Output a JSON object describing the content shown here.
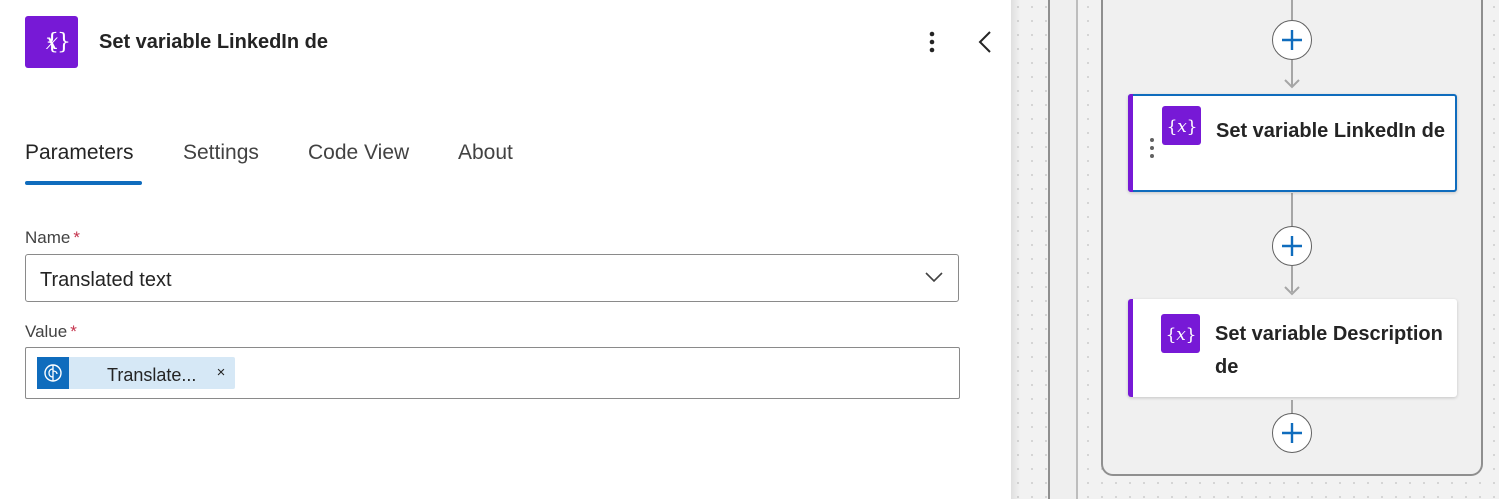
{
  "panel": {
    "title": "Set variable LinkedIn de",
    "icon": "variable-icon",
    "more_icon": "more-vertical-icon",
    "collapse_icon": "chevron-left-icon",
    "tabs": [
      {
        "label": "Parameters",
        "active": true
      },
      {
        "label": "Settings",
        "active": false
      },
      {
        "label": "Code View",
        "active": false
      },
      {
        "label": "About",
        "active": false
      }
    ],
    "fields": {
      "name": {
        "label": "Name",
        "required_mark": "*",
        "value": "Translated text",
        "icon": "chevron-down-icon"
      },
      "value": {
        "label": "Value",
        "required_mark": "*",
        "token": {
          "label": "Translate...",
          "icon": "ai-brain-icon",
          "close": "×"
        }
      }
    }
  },
  "canvas": {
    "nodes": [
      {
        "title": "Set variable LinkedIn de",
        "selected": true,
        "icon": "variable-icon"
      },
      {
        "title": "Set variable Description de",
        "selected": false,
        "icon": "variable-icon"
      }
    ],
    "add_icon": "plus-icon"
  },
  "colors": {
    "accent": "#7719d6",
    "primary": "#0f6cbd",
    "required": "#c4314b",
    "canvas_bg": "#f2f2f2"
  }
}
